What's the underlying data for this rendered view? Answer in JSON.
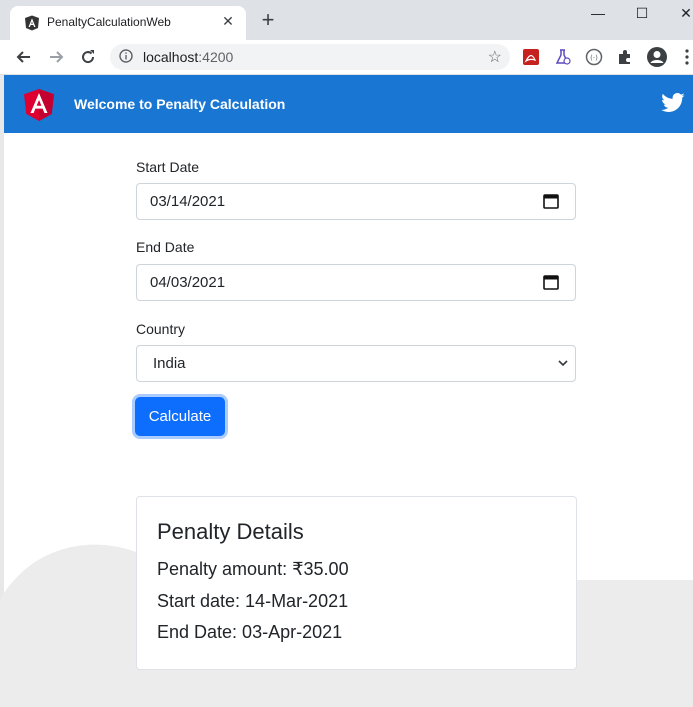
{
  "browser": {
    "tab_title": "PenaltyCalculationWeb",
    "tab_close": "✕",
    "new_tab": "+",
    "url_host": "localhost",
    "url_port": ":4200",
    "window_minimize": "—",
    "window_maximize": "☐",
    "window_close": "✕"
  },
  "header": {
    "title": "Welcome to Penalty Calculation",
    "accent_color": "#1976d2"
  },
  "form": {
    "start_date_label": "Start Date",
    "start_date_value": "03/14/2021",
    "end_date_label": "End Date",
    "end_date_value": "04/03/2021",
    "country_label": "Country",
    "country_value": "India",
    "calculate_label": "Calculate"
  },
  "details": {
    "title": "Penalty Details",
    "amount_line": "Penalty amount: ₹35.00",
    "start_line": "Start date: 14-Mar-2021",
    "end_line": "End Date: 03-Apr-2021"
  }
}
